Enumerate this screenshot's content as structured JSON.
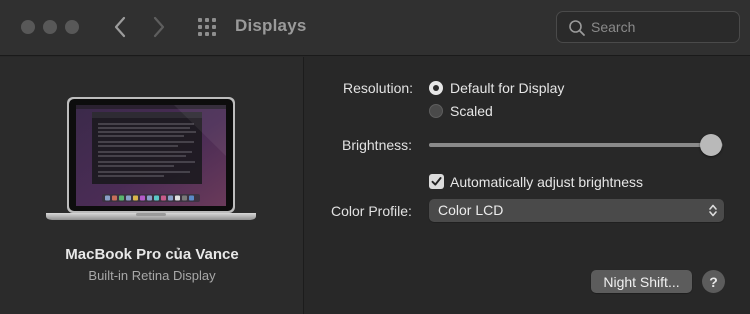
{
  "window": {
    "title": "Displays"
  },
  "search": {
    "placeholder": "Search"
  },
  "device": {
    "name": "MacBook Pro của Vance",
    "subtitle": "Built-in Retina Display"
  },
  "settings": {
    "resolution_label": "Resolution:",
    "resolution_options": [
      {
        "label": "Default for Display",
        "selected": true
      },
      {
        "label": "Scaled",
        "selected": false
      }
    ],
    "brightness_label": "Brightness:",
    "brightness_level": 0.96,
    "auto_brightness_label": "Automatically adjust brightness",
    "auto_brightness_checked": true,
    "color_profile_label": "Color Profile:",
    "color_profile_value": "Color LCD"
  },
  "buttons": {
    "night_shift": "Night Shift...",
    "help": "?"
  },
  "icons": {
    "back": "chevron-left-icon",
    "forward": "chevron-right-icon",
    "grid": "grid-icon",
    "search": "search-icon",
    "popup": "chevron-up-down-icon",
    "check": "checkmark-icon"
  },
  "colors": {
    "window_bg": "#282828",
    "toolbar_bg": "#303030",
    "control_bg": "#4a4a4a",
    "button_bg": "#5c5c5c"
  }
}
